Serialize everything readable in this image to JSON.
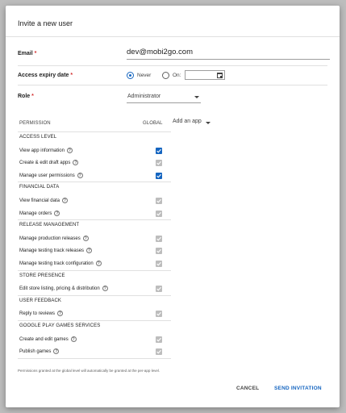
{
  "dialog": {
    "title": "Invite a new user"
  },
  "form": {
    "email": {
      "label": "Email",
      "required_mark": "*",
      "value": "dev@mobi2go.com"
    },
    "access_expiry": {
      "label": "Access expiry date",
      "required_mark": "*",
      "option_never": "Never",
      "option_on": "On:",
      "selected": "Never",
      "date_value": ""
    },
    "role": {
      "label": "Role",
      "required_mark": "*",
      "value": "Administrator"
    }
  },
  "permissions": {
    "header_permission": "PERMISSION",
    "header_global": "GLOBAL",
    "add_app_label": "Add an app",
    "sections": [
      {
        "title": "ACCESS LEVEL",
        "items": [
          {
            "label": "View app information",
            "state": "checked"
          },
          {
            "label": "Create & edit draft apps",
            "state": "locked"
          },
          {
            "label": "Manage user permissions",
            "state": "checked"
          }
        ]
      },
      {
        "title": "FINANCIAL DATA",
        "items": [
          {
            "label": "View financial data",
            "state": "locked"
          },
          {
            "label": "Manage orders",
            "state": "locked"
          }
        ]
      },
      {
        "title": "RELEASE MANAGEMENT",
        "items": [
          {
            "label": "Manage production releases",
            "state": "locked"
          },
          {
            "label": "Manage testing track releases",
            "state": "locked"
          },
          {
            "label": "Manage testing track configuration",
            "state": "locked"
          }
        ]
      },
      {
        "title": "STORE PRESENCE",
        "items": [
          {
            "label": "Edit store listing, pricing & distribution",
            "state": "locked"
          }
        ]
      },
      {
        "title": "USER FEEDBACK",
        "items": [
          {
            "label": "Reply to reviews",
            "state": "locked"
          }
        ]
      },
      {
        "title": "GOOGLE PLAY GAMES SERVICES",
        "items": [
          {
            "label": "Create and edit games",
            "state": "locked"
          },
          {
            "label": "Publish games",
            "state": "locked"
          }
        ]
      }
    ],
    "footnote": "Permissions granted at the global level will automatically be granted at the per-app level."
  },
  "actions": {
    "cancel_label": "CANCEL",
    "send_label": "SEND INVITATION"
  },
  "colors": {
    "accent": "#1565c0",
    "required": "#d32f2f",
    "disabled_check": "#bdbdbd",
    "backdrop": "#bdbdbd"
  }
}
